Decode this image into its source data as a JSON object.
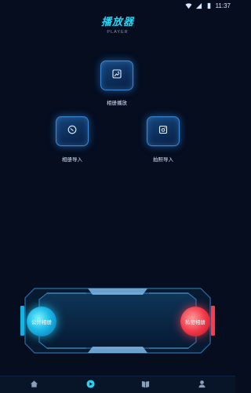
{
  "status": {
    "time": "11:37"
  },
  "header": {
    "title": "播放器",
    "subtitle": "PLAYER"
  },
  "tiles": [
    {
      "label": "相册播放",
      "icon": "album-play-icon"
    },
    {
      "label": "相册导入",
      "icon": "album-import-icon"
    },
    {
      "label": "拍照导入",
      "icon": "camera-import-icon"
    }
  ],
  "controller": {
    "left_button": "公开相册",
    "right_button": "私密相册"
  },
  "nav": {
    "items": [
      "home-icon",
      "play-icon",
      "book-icon",
      "profile-icon"
    ],
    "active_index": 1
  },
  "colors": {
    "accent": "#27d3f2",
    "background": "#050d1f",
    "danger": "#f23b4a"
  }
}
